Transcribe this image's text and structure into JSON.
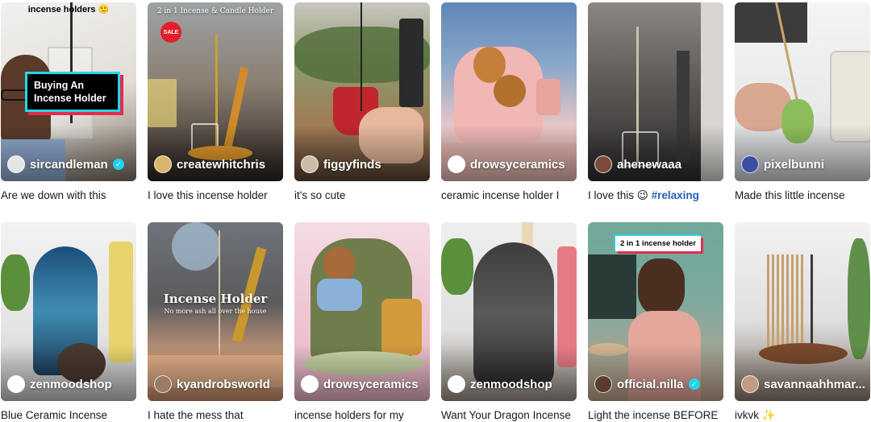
{
  "colors": {
    "accent_tag": "#2b5db9",
    "verified": "#20d5ec",
    "sale": "#e51d2a"
  },
  "row1": [
    {
      "username": "sircandleman",
      "verified": true,
      "caption": "Are we down with this",
      "overlay_top": "incense holders 🙂",
      "overlay_box": "Buying An Incense Holder"
    },
    {
      "username": "createwhitchris",
      "verified": false,
      "caption": "I love this incense holder",
      "overlay_title": "2 in 1 Incense & Candle Holder",
      "sale_badge": "SALE"
    },
    {
      "username": "figgyfinds",
      "verified": false,
      "caption": "it's so cute"
    },
    {
      "username": "drowsyceramics",
      "verified": false,
      "caption": "ceramic incense holder I"
    },
    {
      "username": "ahenewaaa",
      "verified": false,
      "caption": "I love this 😉",
      "caption_tag": "#relaxing"
    },
    {
      "username": "pixelbunni",
      "verified": false,
      "caption": "Made this little incense"
    }
  ],
  "row2": [
    {
      "username": "zenmoodshop",
      "verified": false,
      "caption": "Blue Ceramic Incense"
    },
    {
      "username": "kyandrobsworld",
      "verified": false,
      "caption": "I hate the mess that",
      "overlay_title": "Incense Holder",
      "overlay_sub": "No more ash all over the house"
    },
    {
      "username": "drowsyceramics",
      "verified": false,
      "caption": "incense holders for my"
    },
    {
      "username": "zenmoodshop",
      "verified": false,
      "caption": "Want Your Dragon Incense"
    },
    {
      "username": "official.nilla",
      "verified": true,
      "caption": "Light the incense BEFORE",
      "overlay_label": "2 in 1 incense holder"
    },
    {
      "username": "savannaahhmar...",
      "verified": false,
      "caption": "ivkvk ✨"
    }
  ]
}
